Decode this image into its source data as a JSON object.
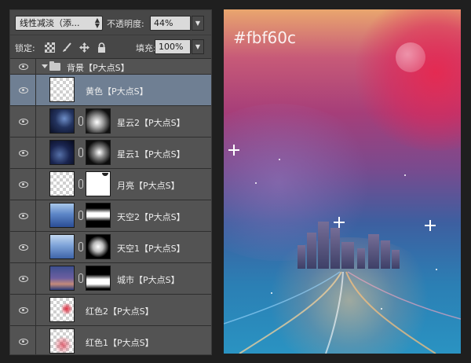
{
  "layers_panel": {
    "blend_mode": "线性减淡（添...",
    "opacity_label": "不透明度:",
    "opacity_value": "44%",
    "lock_label": "锁定:",
    "fill_label": "填充:",
    "fill_value": "100%",
    "group": {
      "name": "背景【P大点S】"
    },
    "layers": [
      {
        "name": "黄色【P大点S】",
        "selected": true,
        "mask": false,
        "thumb": "checker"
      },
      {
        "name": "星云2【P大点S】",
        "selected": false,
        "mask": true,
        "thumb": "nebula"
      },
      {
        "name": "星云1【P大点S】",
        "selected": false,
        "mask": true,
        "thumb": "nebula"
      },
      {
        "name": "月亮【P大点S】",
        "selected": false,
        "mask": true,
        "thumb": "checker"
      },
      {
        "name": "天空2【P大点S】",
        "selected": false,
        "mask": true,
        "thumb": "sky"
      },
      {
        "name": "天空1【P大点S】",
        "selected": false,
        "mask": true,
        "thumb": "sky"
      },
      {
        "name": "城市【P大点S】",
        "selected": false,
        "mask": true,
        "thumb": "city"
      },
      {
        "name": "红色2【P大点S】",
        "selected": false,
        "mask": false,
        "thumb": "red"
      },
      {
        "name": "红色1【P大点S】",
        "selected": false,
        "mask": false,
        "thumb": "red"
      }
    ]
  },
  "canvas": {
    "color_label": "#fbf60c"
  },
  "colors": {
    "panel_bg": "#535353",
    "selected_row": "#6f7f93",
    "accent_red": "#e62850"
  }
}
